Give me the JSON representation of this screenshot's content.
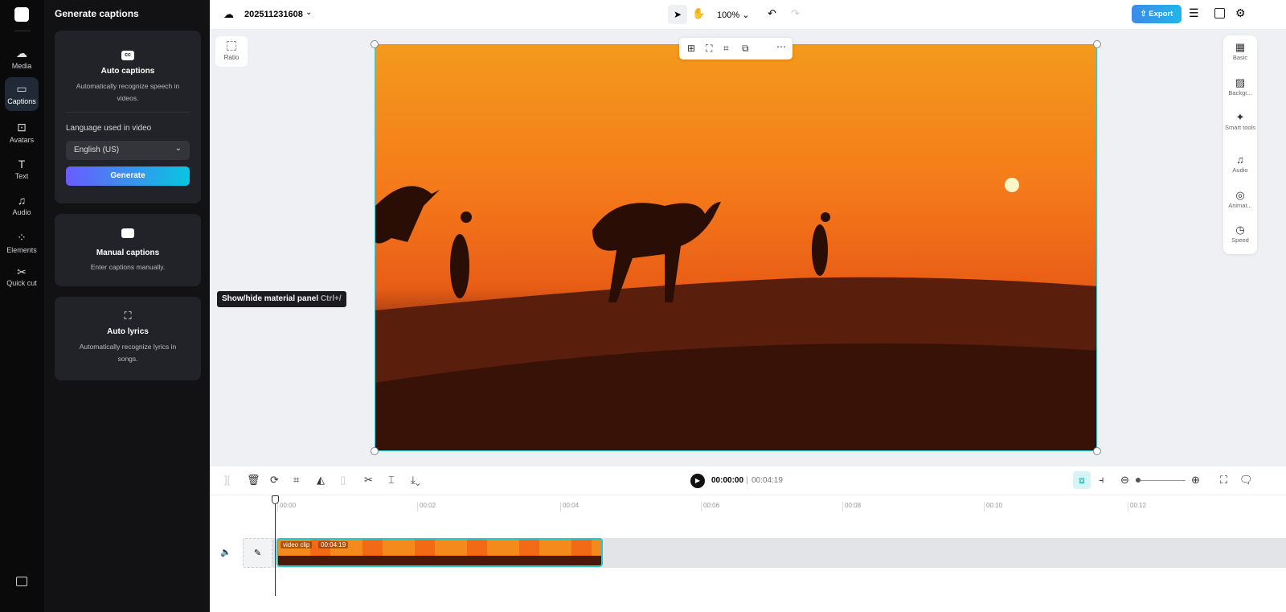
{
  "rail": {
    "items": [
      {
        "label": "Media",
        "icon": "cloud-upload-icon"
      },
      {
        "label": "Captions",
        "icon": "captions-icon"
      },
      {
        "label": "Avatars",
        "icon": "avatar-icon"
      },
      {
        "label": "Text",
        "icon": "text-icon"
      },
      {
        "label": "Audio",
        "icon": "music-icon"
      },
      {
        "label": "Elements",
        "icon": "elements-icon"
      },
      {
        "label": "Quick cut",
        "icon": "quick-cut-icon"
      }
    ]
  },
  "panel": {
    "title": "Generate captions",
    "auto": {
      "icon_text": "cc",
      "title": "Auto captions",
      "desc": "Automatically recognize speech in videos.",
      "lang_label": "Language used in video",
      "lang_value": "English (US)",
      "generate": "Generate"
    },
    "manual": {
      "title": "Manual captions",
      "desc": "Enter captions manually."
    },
    "lyrics": {
      "title": "Auto lyrics",
      "desc": "Automatically recognize lyrics in songs."
    }
  },
  "tooltip": {
    "text": "Show/hide material panel",
    "shortcut": "Ctrl+/"
  },
  "top": {
    "project": "202511231608",
    "zoom": "100%",
    "export": "Export"
  },
  "canvas": {
    "ratio": "Ratio"
  },
  "right": {
    "items": [
      "Basic",
      "Backgr...",
      "Smart tools",
      "Audio",
      "Animat...",
      "Speed"
    ]
  },
  "player": {
    "current": "00:00:00",
    "total": "00:04:19"
  },
  "timeline": {
    "ticks": [
      "00:00",
      "00:02",
      "00:04",
      "00:06",
      "00:08",
      "00:10",
      "00:12"
    ],
    "clip_label": "video clip",
    "clip_duration": "00:04:19"
  },
  "colors": {
    "accent": "#33c6d0",
    "export": "#2f8ff0"
  }
}
